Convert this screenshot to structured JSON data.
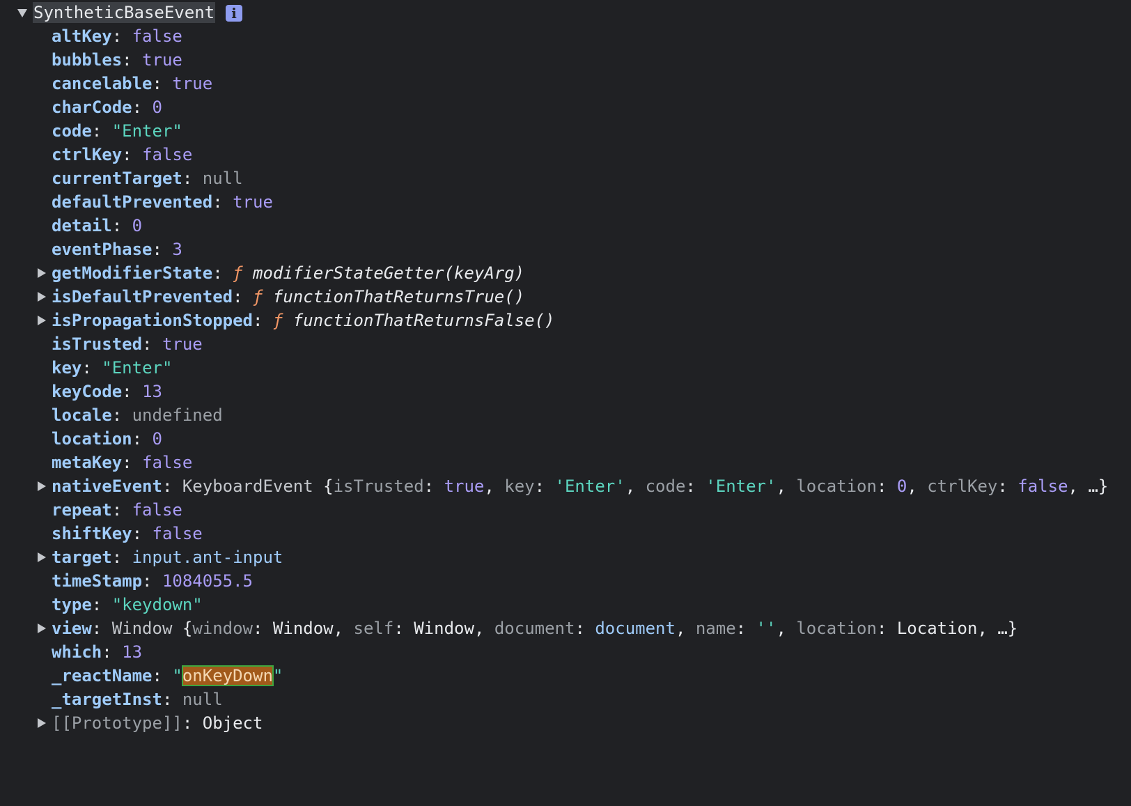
{
  "header": {
    "title": "SyntheticBaseEvent",
    "info_label": "i"
  },
  "props": {
    "altKey": {
      "k": "altKey",
      "v": "false"
    },
    "bubbles": {
      "k": "bubbles",
      "v": "true"
    },
    "cancelable": {
      "k": "cancelable",
      "v": "true"
    },
    "charCode": {
      "k": "charCode",
      "v": "0"
    },
    "code": {
      "k": "code",
      "v": "\"Enter\""
    },
    "ctrlKey": {
      "k": "ctrlKey",
      "v": "false"
    },
    "currentTarget": {
      "k": "currentTarget",
      "v": "null"
    },
    "defaultPrevented": {
      "k": "defaultPrevented",
      "v": "true"
    },
    "detail": {
      "k": "detail",
      "v": "0"
    },
    "eventPhase": {
      "k": "eventPhase",
      "v": "3"
    },
    "getModifierState": {
      "k": "getModifierState",
      "f": "ƒ",
      "v": "modifierStateGetter(keyArg)"
    },
    "isDefaultPrevented": {
      "k": "isDefaultPrevented",
      "f": "ƒ",
      "v": "functionThatReturnsTrue()"
    },
    "isPropagationStopped": {
      "k": "isPropagationStopped",
      "f": "ƒ",
      "v": "functionThatReturnsFalse()"
    },
    "isTrusted": {
      "k": "isTrusted",
      "v": "true"
    },
    "key": {
      "k": "key",
      "v": "\"Enter\""
    },
    "keyCode": {
      "k": "keyCode",
      "v": "13"
    },
    "locale": {
      "k": "locale",
      "v": "undefined"
    },
    "location": {
      "k": "location",
      "v": "0"
    },
    "metaKey": {
      "k": "metaKey",
      "v": "false"
    },
    "nativeEvent": {
      "k": "nativeEvent",
      "cls": "KeyboardEvent",
      "p1k": "isTrusted",
      "p1v": "true",
      "p2k": "key",
      "p2v": "'Enter'",
      "p3k": "code",
      "p3v": "'Enter'",
      "p4k": "location",
      "p4v": "0",
      "p5k": "ctrlKey",
      "p5v": "false",
      "more": "…}"
    },
    "repeat": {
      "k": "repeat",
      "v": "false"
    },
    "shiftKey": {
      "k": "shiftKey",
      "v": "false"
    },
    "target": {
      "k": "target",
      "v": "input.ant-input"
    },
    "timeStamp": {
      "k": "timeStamp",
      "v": "1084055.5"
    },
    "type": {
      "k": "type",
      "v": "\"keydown\""
    },
    "view": {
      "k": "view",
      "cls": "Window",
      "p1k": "window",
      "p1v": "Window",
      "p2k": "self",
      "p2v": "Window",
      "p3k": "document",
      "p3v": "document",
      "p4k": "name",
      "p4v": "''",
      "p5k": "location",
      "p5v": "Location",
      "more": "…}"
    },
    "which": {
      "k": "which",
      "v": "13"
    },
    "reactName": {
      "k": "_reactName",
      "q1": "\"",
      "v": "onKeyDown",
      "q2": "\""
    },
    "targetInst": {
      "k": "_targetInst",
      "v": "null"
    },
    "prototype": {
      "k": "[[Prototype]]",
      "v": "Object"
    }
  },
  "colors": {
    "background": "#202124",
    "key": "#9fcbf9",
    "boolean_number": "#a99cf5",
    "string": "#5cd5bf",
    "function_f": "#f29766",
    "search_highlight": "#a25a1a"
  }
}
